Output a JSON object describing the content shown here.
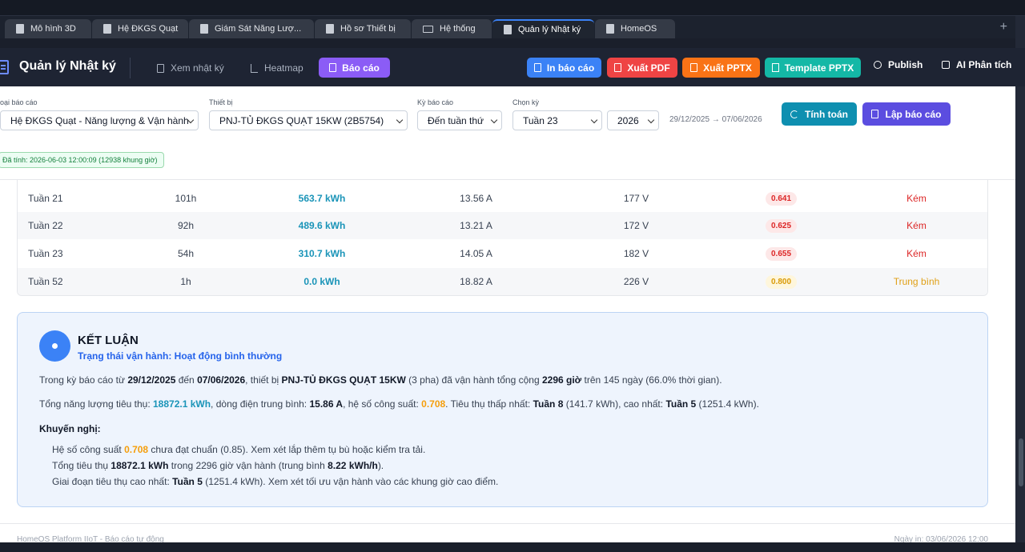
{
  "tabs": [
    {
      "label": "Mô hình 3D",
      "icon": "file-icon"
    },
    {
      "label": "Hệ ĐKGS Quạt",
      "icon": "file-icon"
    },
    {
      "label": "Giám Sát Năng Lượ...",
      "icon": "file-icon"
    },
    {
      "label": "Hồ sơ Thiết bị",
      "icon": "file-icon"
    },
    {
      "label": "Hệ thống",
      "icon": "monitor-icon"
    },
    {
      "label": "Quản lý Nhật ký",
      "icon": "file-icon"
    },
    {
      "label": "HomeOS",
      "icon": "file-icon"
    }
  ],
  "tab_add": "+",
  "header": {
    "title": "Quản lý Nhật ký",
    "nav": {
      "view_log": "Xem nhật ký",
      "heatmap": "Heatmap",
      "report": "Báo cáo"
    },
    "actions": {
      "print": "In báo cáo",
      "pdf": "Xuất PDF",
      "pptx": "Xuất PPTX",
      "template": "Template PPTX",
      "publish": "Publish",
      "ai": "AI Phân tích"
    }
  },
  "filters": {
    "report_type_label": "oại báo cáo",
    "report_type_value": "Hệ ĐKGS Quạt - Năng lượng & Vận hành",
    "device_label": "Thiết bị",
    "device_value": "PNJ-TỦ ĐKGS QUẠT 15KW (2B5754)",
    "period_label": "Kỳ báo cáo",
    "period_value": "Đến tuần thứ",
    "choose_label": "Chọn kỳ",
    "week_value": "Tuần 23",
    "year_value": "2026",
    "range": "29/12/2025 → 07/06/2026",
    "compute_btn": "Tính toán",
    "make_btn": "Lập báo cáo",
    "computed_badge": "Đã tính: 2026-06-03 12:00:09 (12938 khung giờ)"
  },
  "rows": [
    {
      "week": "Tuần 21",
      "hours": "101h",
      "energy": "563.7 kWh",
      "current": "13.56 A",
      "voltage": "177 V",
      "pf": "0.641",
      "rating": "Kém",
      "level": "bad"
    },
    {
      "week": "Tuần 22",
      "hours": "92h",
      "energy": "489.6 kWh",
      "current": "13.21 A",
      "voltage": "172 V",
      "pf": "0.625",
      "rating": "Kém",
      "level": "bad"
    },
    {
      "week": "Tuần 23",
      "hours": "54h",
      "energy": "310.7 kWh",
      "current": "14.05 A",
      "voltage": "182 V",
      "pf": "0.655",
      "rating": "Kém",
      "level": "bad"
    },
    {
      "week": "Tuần 52",
      "hours": "1h",
      "energy": "0.0 kWh",
      "current": "18.82 A",
      "voltage": "226 V",
      "pf": "0.800",
      "rating": "Trung bình",
      "level": "mid"
    }
  ],
  "conclusion": {
    "title": "KẾT LUẬN",
    "status": "Trạng thái vận hành: Hoạt động bình thường",
    "p1": {
      "a": "Trong kỳ báo cáo từ ",
      "from": "29/12/2025",
      "b": " đến ",
      "to": "07/06/2026",
      "c": ", thiết bị ",
      "device": "PNJ-TỦ ĐKGS QUẠT 15KW",
      "d": " (3 pha) đã vận hành tổng cộng ",
      "hours": "2296 giờ",
      "e": " trên 145 ngày (66.0% thời gian)."
    },
    "p2": {
      "a": "Tổng năng lượng tiêu thụ: ",
      "energy": "18872.1 kWh",
      "b": ", dòng điện trung bình: ",
      "current": "15.86 A",
      "c": ", hệ số công suất: ",
      "pf": "0.708",
      "d": ". Tiêu thụ thấp nhất: ",
      "low": "Tuần 8",
      "e": " (141.7 kWh), cao nhất: ",
      "high": "Tuần 5",
      "f": " (1251.4 kWh)."
    },
    "rec_title": "Khuyến nghị:",
    "rec1": {
      "a": "Hệ số công suất ",
      "pf": "0.708",
      "b": " chưa đạt chuẩn (0.85). Xem xét lắp thêm tụ bù hoặc kiểm tra tải."
    },
    "rec2": {
      "a": "Tổng tiêu thụ ",
      "energy": "18872.1 kWh",
      "b": " trong 2296 giờ vận hành (trung bình ",
      "avg": "8.22 kWh/h",
      "c": ")."
    },
    "rec3": {
      "a": "Giai đoạn tiêu thụ cao nhất: ",
      "week": "Tuần 5",
      "b": " (1251.4 kWh). Xem xét tối ưu vận hành vào các khung giờ cao điểm."
    }
  },
  "footer": {
    "left": "HomeOS Platform IIoT - Báo cáo tự động",
    "right": "Ngày in: 03/06/2026 12:00"
  },
  "colors": {
    "accent": "#3b82f6",
    "print": "#3b82f6",
    "pdf": "#ef4444",
    "pptx": "#f97316",
    "template": "#14b8a6",
    "report": "#8b5cf6",
    "compute": "#0e8fb0",
    "make": "#5b4de0"
  }
}
